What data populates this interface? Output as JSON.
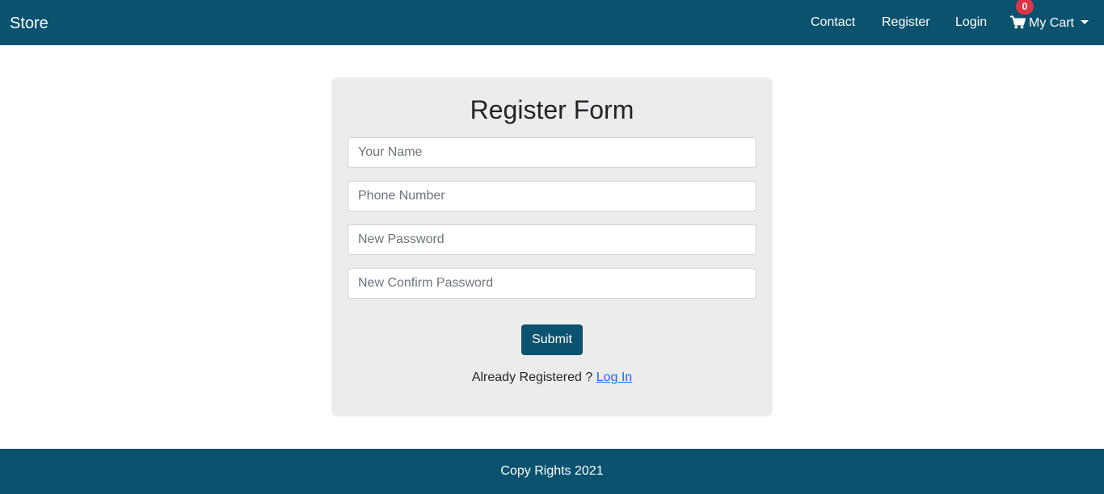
{
  "navbar": {
    "brand": "Store",
    "links": {
      "contact": "Contact",
      "register": "Register",
      "login": "Login"
    },
    "cart": {
      "label": "My Cart",
      "count": "0"
    }
  },
  "form": {
    "title": "Register Form",
    "name_placeholder": "Your Name",
    "phone_placeholder": "Phone Number",
    "password_placeholder": "New Password",
    "confirm_placeholder": "New Confirm Password",
    "submit_label": "Submit",
    "already_text": "Already Registered ?",
    "login_link": "Log In"
  },
  "footer": {
    "text": "Copy Rights 2021"
  },
  "colors": {
    "primary": "#0b526f",
    "card_bg": "#ececec",
    "badge": "#dc3545",
    "link": "#0d6efd"
  },
  "icons": {
    "cart": "shopping-cart-icon",
    "dropdown": "caret-down-icon"
  }
}
